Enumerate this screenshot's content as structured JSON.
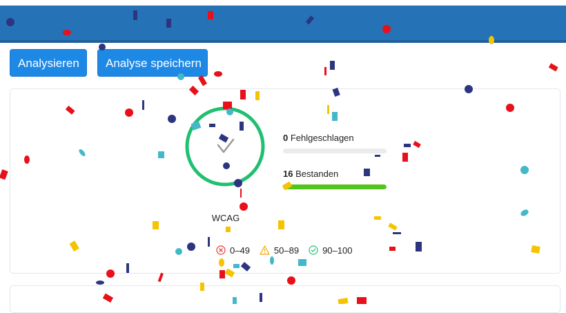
{
  "toolbar": {
    "analyze_label": "Analysieren",
    "save_label": "Analyse speichern"
  },
  "score_card": {
    "category": "WCAG",
    "status_icon": "check-icon",
    "ring_color": "#20c070",
    "failed": {
      "count": "0",
      "label": "Fehlgeschlagen",
      "fraction": 0
    },
    "passed": {
      "count": "16",
      "label": "Bestanden",
      "fraction": 1,
      "bar_color": "#52c41a"
    }
  },
  "legend": [
    {
      "icon": "error-circle-icon",
      "range": "0–49",
      "color": "#e53935"
    },
    {
      "icon": "warning-triangle-icon",
      "range": "50–89",
      "color": "#f0a500"
    },
    {
      "icon": "check-circle-icon",
      "range": "90–100",
      "color": "#20c070"
    }
  ],
  "colors": {
    "header": "#2672b7",
    "button": "#1e88e5"
  }
}
